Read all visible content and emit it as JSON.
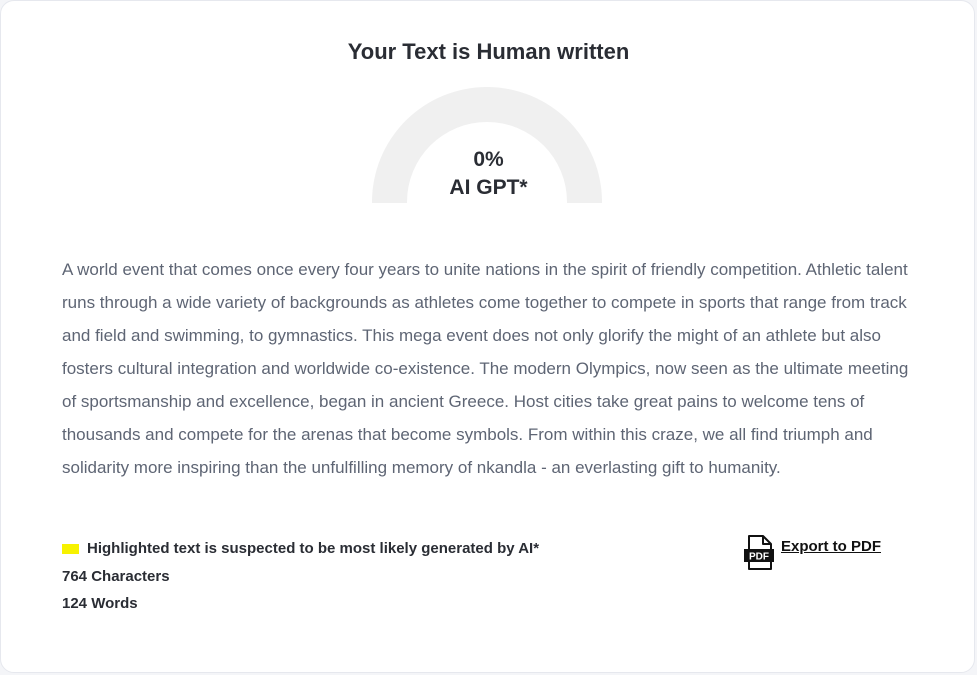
{
  "result": {
    "title": "Your Text is Human written",
    "gauge_value": "0%",
    "gauge_label": "AI GPT*",
    "ai_percent": 0
  },
  "analyzed_text": "A world event that comes once every four years to unite nations in the spirit of friendly competition. Athletic talent runs through a wide variety of backgrounds as athletes come together to compete in sports that range from track and field and swimming, to gymnastics. This mega event does not only glorify the might of an athlete but also fosters cultural integration and worldwide co-existence. The modern Olympics, now seen as the ultimate meeting of sportsmanship and excellence, began in ancient Greece. Host cities take great pains to welcome tens of thousands and compete for the arenas that become symbols. From within this craze, we all find triumph and solidarity more inspiring than the unfulfilling memory of nkandla - an everlasting gift to humanity.",
  "legend": {
    "text": "Highlighted text is suspected to be most likely generated by AI*",
    "highlight_color": "#f7f200"
  },
  "stats": {
    "characters": "764 Characters",
    "words": "124 Words"
  },
  "export": {
    "label": "Export to PDF",
    "icon": "pdf-file-icon",
    "icon_text": "PDF"
  }
}
